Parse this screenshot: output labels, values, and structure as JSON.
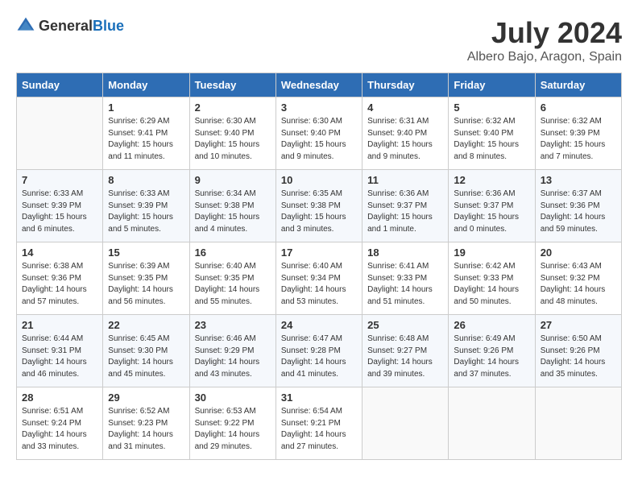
{
  "logo": {
    "general": "General",
    "blue": "Blue"
  },
  "title": "July 2024",
  "location": "Albero Bajo, Aragon, Spain",
  "weekdays": [
    "Sunday",
    "Monday",
    "Tuesday",
    "Wednesday",
    "Thursday",
    "Friday",
    "Saturday"
  ],
  "weeks": [
    [
      {
        "day": "",
        "info": ""
      },
      {
        "day": "1",
        "info": "Sunrise: 6:29 AM\nSunset: 9:41 PM\nDaylight: 15 hours\nand 11 minutes."
      },
      {
        "day": "2",
        "info": "Sunrise: 6:30 AM\nSunset: 9:40 PM\nDaylight: 15 hours\nand 10 minutes."
      },
      {
        "day": "3",
        "info": "Sunrise: 6:30 AM\nSunset: 9:40 PM\nDaylight: 15 hours\nand 9 minutes."
      },
      {
        "day": "4",
        "info": "Sunrise: 6:31 AM\nSunset: 9:40 PM\nDaylight: 15 hours\nand 9 minutes."
      },
      {
        "day": "5",
        "info": "Sunrise: 6:32 AM\nSunset: 9:40 PM\nDaylight: 15 hours\nand 8 minutes."
      },
      {
        "day": "6",
        "info": "Sunrise: 6:32 AM\nSunset: 9:39 PM\nDaylight: 15 hours\nand 7 minutes."
      }
    ],
    [
      {
        "day": "7",
        "info": "Sunrise: 6:33 AM\nSunset: 9:39 PM\nDaylight: 15 hours\nand 6 minutes."
      },
      {
        "day": "8",
        "info": "Sunrise: 6:33 AM\nSunset: 9:39 PM\nDaylight: 15 hours\nand 5 minutes."
      },
      {
        "day": "9",
        "info": "Sunrise: 6:34 AM\nSunset: 9:38 PM\nDaylight: 15 hours\nand 4 minutes."
      },
      {
        "day": "10",
        "info": "Sunrise: 6:35 AM\nSunset: 9:38 PM\nDaylight: 15 hours\nand 3 minutes."
      },
      {
        "day": "11",
        "info": "Sunrise: 6:36 AM\nSunset: 9:37 PM\nDaylight: 15 hours\nand 1 minute."
      },
      {
        "day": "12",
        "info": "Sunrise: 6:36 AM\nSunset: 9:37 PM\nDaylight: 15 hours\nand 0 minutes."
      },
      {
        "day": "13",
        "info": "Sunrise: 6:37 AM\nSunset: 9:36 PM\nDaylight: 14 hours\nand 59 minutes."
      }
    ],
    [
      {
        "day": "14",
        "info": "Sunrise: 6:38 AM\nSunset: 9:36 PM\nDaylight: 14 hours\nand 57 minutes."
      },
      {
        "day": "15",
        "info": "Sunrise: 6:39 AM\nSunset: 9:35 PM\nDaylight: 14 hours\nand 56 minutes."
      },
      {
        "day": "16",
        "info": "Sunrise: 6:40 AM\nSunset: 9:35 PM\nDaylight: 14 hours\nand 55 minutes."
      },
      {
        "day": "17",
        "info": "Sunrise: 6:40 AM\nSunset: 9:34 PM\nDaylight: 14 hours\nand 53 minutes."
      },
      {
        "day": "18",
        "info": "Sunrise: 6:41 AM\nSunset: 9:33 PM\nDaylight: 14 hours\nand 51 minutes."
      },
      {
        "day": "19",
        "info": "Sunrise: 6:42 AM\nSunset: 9:33 PM\nDaylight: 14 hours\nand 50 minutes."
      },
      {
        "day": "20",
        "info": "Sunrise: 6:43 AM\nSunset: 9:32 PM\nDaylight: 14 hours\nand 48 minutes."
      }
    ],
    [
      {
        "day": "21",
        "info": "Sunrise: 6:44 AM\nSunset: 9:31 PM\nDaylight: 14 hours\nand 46 minutes."
      },
      {
        "day": "22",
        "info": "Sunrise: 6:45 AM\nSunset: 9:30 PM\nDaylight: 14 hours\nand 45 minutes."
      },
      {
        "day": "23",
        "info": "Sunrise: 6:46 AM\nSunset: 9:29 PM\nDaylight: 14 hours\nand 43 minutes."
      },
      {
        "day": "24",
        "info": "Sunrise: 6:47 AM\nSunset: 9:28 PM\nDaylight: 14 hours\nand 41 minutes."
      },
      {
        "day": "25",
        "info": "Sunrise: 6:48 AM\nSunset: 9:27 PM\nDaylight: 14 hours\nand 39 minutes."
      },
      {
        "day": "26",
        "info": "Sunrise: 6:49 AM\nSunset: 9:26 PM\nDaylight: 14 hours\nand 37 minutes."
      },
      {
        "day": "27",
        "info": "Sunrise: 6:50 AM\nSunset: 9:26 PM\nDaylight: 14 hours\nand 35 minutes."
      }
    ],
    [
      {
        "day": "28",
        "info": "Sunrise: 6:51 AM\nSunset: 9:24 PM\nDaylight: 14 hours\nand 33 minutes."
      },
      {
        "day": "29",
        "info": "Sunrise: 6:52 AM\nSunset: 9:23 PM\nDaylight: 14 hours\nand 31 minutes."
      },
      {
        "day": "30",
        "info": "Sunrise: 6:53 AM\nSunset: 9:22 PM\nDaylight: 14 hours\nand 29 minutes."
      },
      {
        "day": "31",
        "info": "Sunrise: 6:54 AM\nSunset: 9:21 PM\nDaylight: 14 hours\nand 27 minutes."
      },
      {
        "day": "",
        "info": ""
      },
      {
        "day": "",
        "info": ""
      },
      {
        "day": "",
        "info": ""
      }
    ]
  ]
}
